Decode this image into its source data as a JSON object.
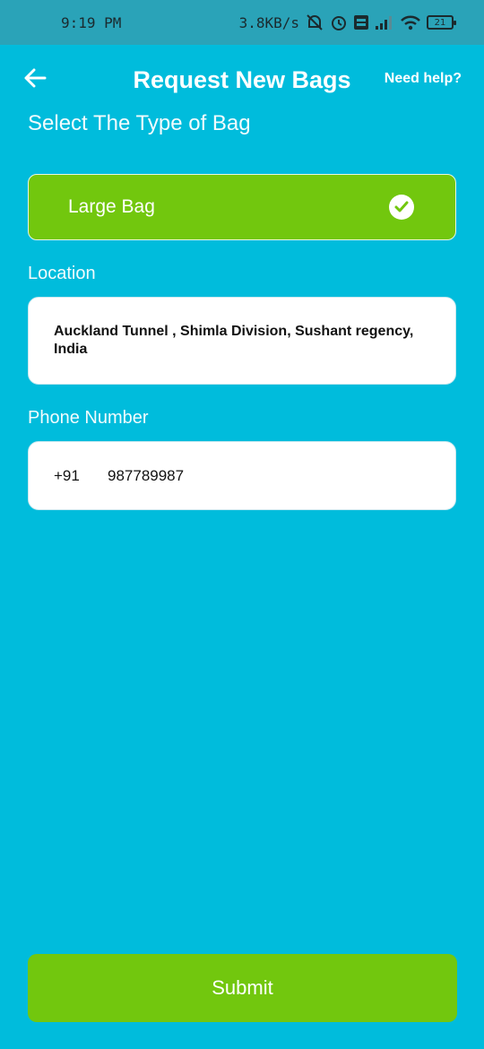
{
  "status_bar": {
    "time": "9:19 PM",
    "speed": "3.8KB/s",
    "battery": "21",
    "icons": [
      "alarm-off-icon",
      "alarm-icon",
      "volte-icon",
      "signal-icon",
      "wifi-icon",
      "battery-icon"
    ]
  },
  "header": {
    "title": "Request New Bags",
    "help": "Need help?",
    "back_icon": "arrow-left-icon"
  },
  "bag_section": {
    "label": "Select The Type of Bag",
    "selected": "Large Bag",
    "check_icon": "check-circle-icon"
  },
  "location": {
    "label": "Location",
    "value": "Auckland Tunnel , Shimla Division, Sushant regency, India"
  },
  "phone": {
    "label": "Phone Number",
    "code": "+91",
    "number": "987789987"
  },
  "submit": {
    "label": "Submit"
  },
  "colors": {
    "background": "#00bcdc",
    "status_bar": "#2aa3b8",
    "accent_green": "#72c70e"
  }
}
